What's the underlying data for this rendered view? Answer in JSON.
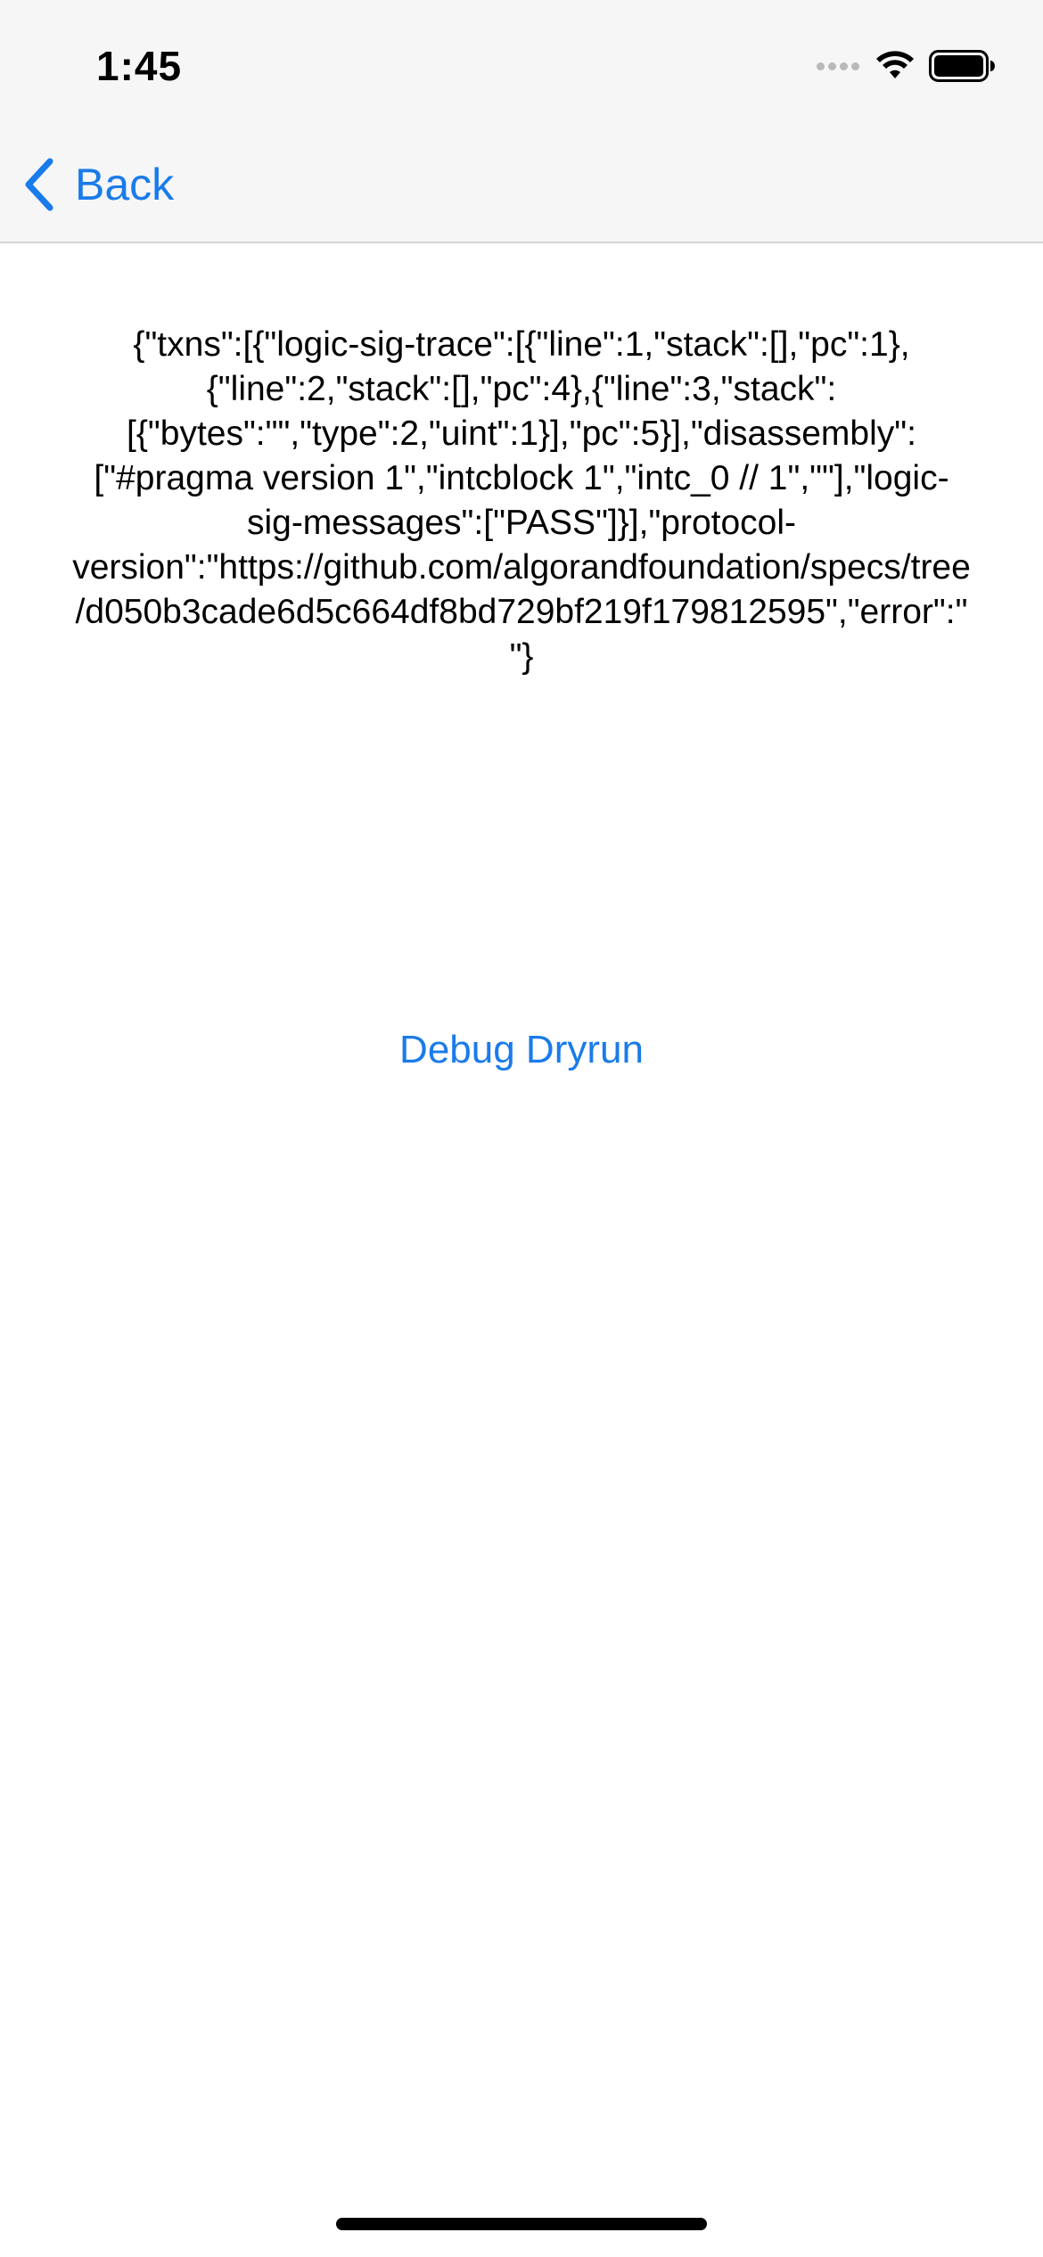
{
  "status_bar": {
    "time": "1:45"
  },
  "nav": {
    "back_label": "Back",
    "icon": "chevron-left-icon"
  },
  "content": {
    "result_text": "{\"txns\":[{\"logic-sig-trace\":[{\"line\":1,\"stack\":[],\"pc\":1},{\"line\":2,\"stack\":[],\"pc\":4},{\"line\":3,\"stack\":[{\"bytes\":\"\",\"type\":2,\"uint\":1}],\"pc\":5}],\"disassembly\":[\"#pragma version 1\",\"intcblock 1\",\"intc_0 // 1\",\"\"],\"logic-sig-messages\":[\"PASS\"]}],\"protocol-version\":\"https://github.com/algorandfoundation/specs/tree/d050b3cade6d5c664df8bd729bf219f179812595\",\"error\":\"\"}",
    "debug_button_label": "Debug Dryrun"
  },
  "colors": {
    "accent": "#1a7bea",
    "nav_background": "#f6f6f6"
  }
}
